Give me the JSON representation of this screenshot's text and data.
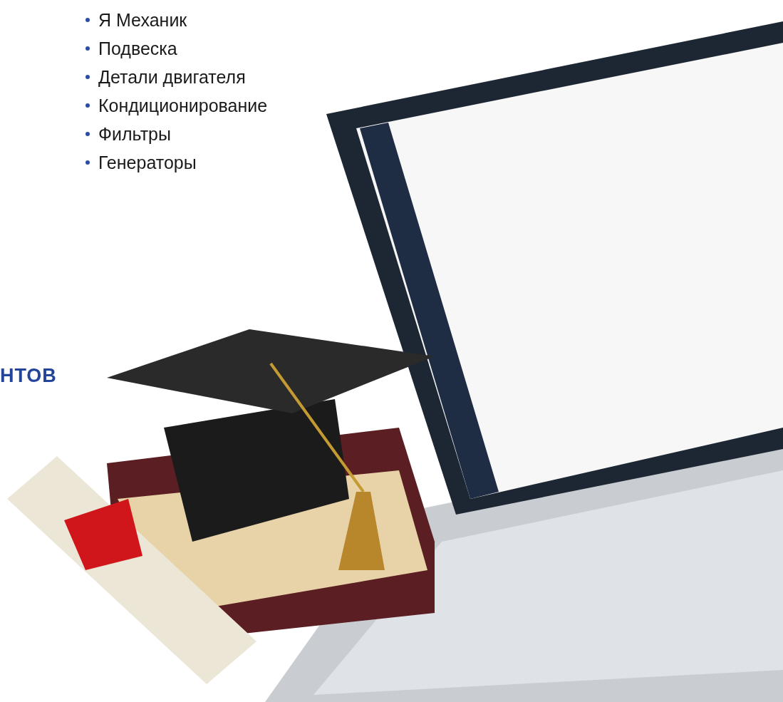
{
  "bullet_list": [
    "Я Механик",
    "Подвеска",
    "Детали двигателя",
    "Кондиционирование",
    "Фильтры",
    "Генераторы"
  ],
  "heading": "НТОВ"
}
